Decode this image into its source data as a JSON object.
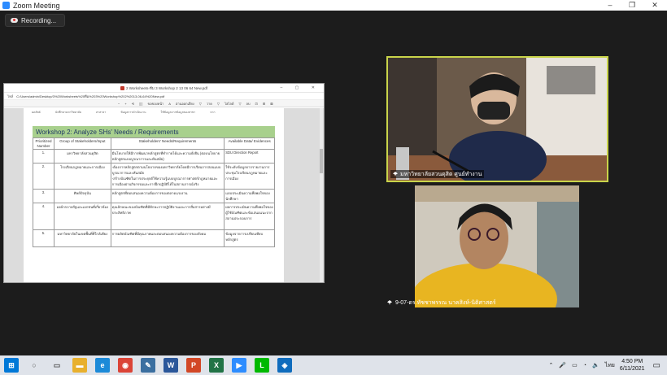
{
  "window": {
    "title": "Zoom Meeting",
    "controls": {
      "minimize": "–",
      "maximize": "❐",
      "close": "✕"
    }
  },
  "recording": {
    "label": "Recording..."
  },
  "shared_screen": {
    "file_title": "2 Worksheets-ทีม 3 Workshop 2 13 06 64 New.pdf",
    "address_prefix": "ไฟล์",
    "address": "C:/Users/admin/Desktop/3%20Worksheets%20ทีม%203%20Workshop%202%2013-06-64%20New.pdf",
    "toolbar": [
      "−",
      "+",
      "⟲",
      "▯▯",
      "ขอของหน้า",
      "A",
      "อ่านออกเสียง",
      "▽",
      "วาด",
      "▽",
      "ไฮไลต์",
      "▽",
      "ลบ",
      "⊡",
      "⊞",
      "⊠"
    ],
    "top_row": [
      "ผลลัพธ์",
      "นักศึกษามหาวิทยาลัย",
      "สาสาธา",
      "ข้อมูลการดำเนินงาน",
      "ใช้ข้อมูลจากข้อมูลของสาขา",
      "จาก"
    ],
    "workshop_title": "Workshop 2: Analyze SHs' Needs / Requirements",
    "table": {
      "headers": [
        "Prioritized Number",
        "Group of Stakeholders/Input",
        "Stakeholders' Needs/Requirements",
        "Available Data/ Evidences"
      ],
      "rows": [
        [
          "1.",
          "มหาวิทยาลัยสวนดุสิต",
          "มีนโยบายให้มีการพัฒนาหลักสูตรที่ทำรายได้และความยั่งยืน (ตอบนโยบายหลักสูตรแบบบูรณาการและทันสมัย)",
          "SDU Direction Report"
        ],
        [
          "2.",
          "โรงเรียนกฎหมายและการเมือง",
          "-ต้องการหลักสูตรตามนโยบายของมหาวิทยาลัยโดยมีการเรียนการสอนแบบบูรณาการและทันสมัย\n-สร้างบัณฑิตในการประยุกต์ใช้ความรู้แบบบูรณาการศาสตร์กฎหมายและการเมืองผ่านกิจกรรมและการฝึกปฏิบัติได้ในสถานการณ์จริง",
          "ใช้ระดับข้อมูลจากรายงานการประชุมโรงเรียนกฎหมายและการเมือง"
        ],
        [
          "3.",
          "ศิษย์ปัจจุบัน",
          "หลักสูตรที่ตอบสนองความต้องการของตลาดแรงงาน",
          "แบบประเมินความพึงพอใจของนักศึกษา"
        ],
        [
          "4.",
          "องค์กรภาครัฐและเอกชนที่เกี่ยวข้อง",
          "คุณลักษณะของบัณฑิตที่มีทักษะการปฏิบัติงานและการสื่อสารอย่างมีประสิทธิภาพ",
          "ผลการประเมินความพึงพอใจของผู้ใช้บัณฑิตและข้อเสนอแนะจากสถานประกอบการ"
        ],
        [
          "5.",
          "มหาวิทยาลัยในเขตพื้นที่ที่ใกล้เคียง",
          "การผลิตบัณฑิตที่มีคุณภาพและตอบสนองความต้องการของสังคม",
          "ข้อมูลจากการเปรียบเทียบหลักสูตร"
        ]
      ]
    }
  },
  "participants": [
    {
      "name": "มหาวิทยาลัยสวนดุสิต ศูนย์ทำงาน",
      "active_speaker": true
    },
    {
      "name": "9-07-ดร.ทัชชาพรรณ นาคสิงห์-นิติศาสตร์",
      "active_speaker": false
    }
  ],
  "taskbar": {
    "apps": [
      {
        "name": "start",
        "glyph": "⊞",
        "color": "#0078d7"
      },
      {
        "name": "search",
        "glyph": "○",
        "color": "#555555"
      },
      {
        "name": "task-view",
        "glyph": "▭",
        "color": "#555555"
      },
      {
        "name": "file-explorer",
        "glyph": "▬",
        "color": "#e8b02e"
      },
      {
        "name": "edge",
        "glyph": "e",
        "color": "#1c8ad8"
      },
      {
        "name": "chrome",
        "glyph": "◉",
        "color": "#db4437"
      },
      {
        "name": "pen",
        "glyph": "✎",
        "color": "#3b6fa0"
      },
      {
        "name": "word",
        "glyph": "W",
        "color": "#2b579a"
      },
      {
        "name": "powerpoint",
        "glyph": "P",
        "color": "#d24726"
      },
      {
        "name": "excel",
        "glyph": "X",
        "color": "#217346"
      },
      {
        "name": "zoom",
        "glyph": "▶",
        "color": "#2d8cff"
      },
      {
        "name": "line",
        "glyph": "L",
        "color": "#00b900"
      },
      {
        "name": "photos",
        "glyph": "◈",
        "color": "#0f6cbd"
      }
    ],
    "tray": {
      "language": "ไทย",
      "time": "4:50 PM",
      "date": "6/11/2021"
    }
  },
  "colors": {
    "active_speaker_border": "#c9d44a",
    "banner_green": "#a8d08d",
    "taskbar_bg": "#dfe3ea"
  }
}
